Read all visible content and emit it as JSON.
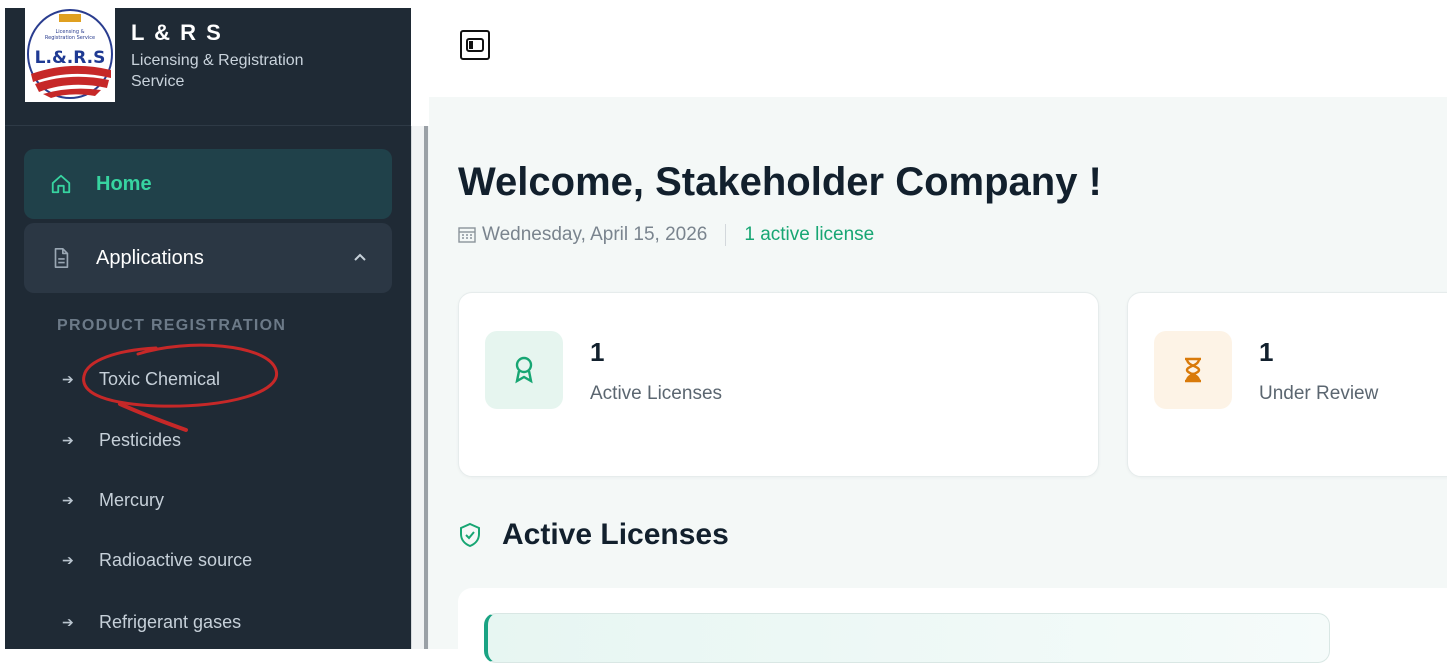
{
  "brand": {
    "title": "L & R S",
    "subtitle": "Licensing & Registration Service",
    "logo_text": "L.&.R.S"
  },
  "sidebar": {
    "home_label": "Home",
    "applications_label": "Applications",
    "section_label": "PRODUCT REGISTRATION",
    "sub_items": [
      {
        "label": "Toxic Chemical"
      },
      {
        "label": "Pesticides"
      },
      {
        "label": "Mercury"
      },
      {
        "label": "Radioactive source"
      },
      {
        "label": "Refrigerant gases"
      }
    ]
  },
  "header": {
    "welcome": "Welcome, Stakeholder Company !",
    "date": "Wednesday, April 15, 2026",
    "active_summary": "1 active license"
  },
  "stats": [
    {
      "value": "1",
      "label": "Active Licenses",
      "icon": "award-icon",
      "bg": "#e6f5ef",
      "color": "#17a673"
    },
    {
      "value": "1",
      "label": "Under Review",
      "icon": "hourglass-icon",
      "bg": "#fdf3e6",
      "color": "#d97a0a"
    }
  ],
  "section": {
    "title": "Active Licenses"
  },
  "colors": {
    "sidebar_bg": "#1f2a35",
    "accent": "#37d4a0",
    "annotation_red": "#c62828"
  }
}
